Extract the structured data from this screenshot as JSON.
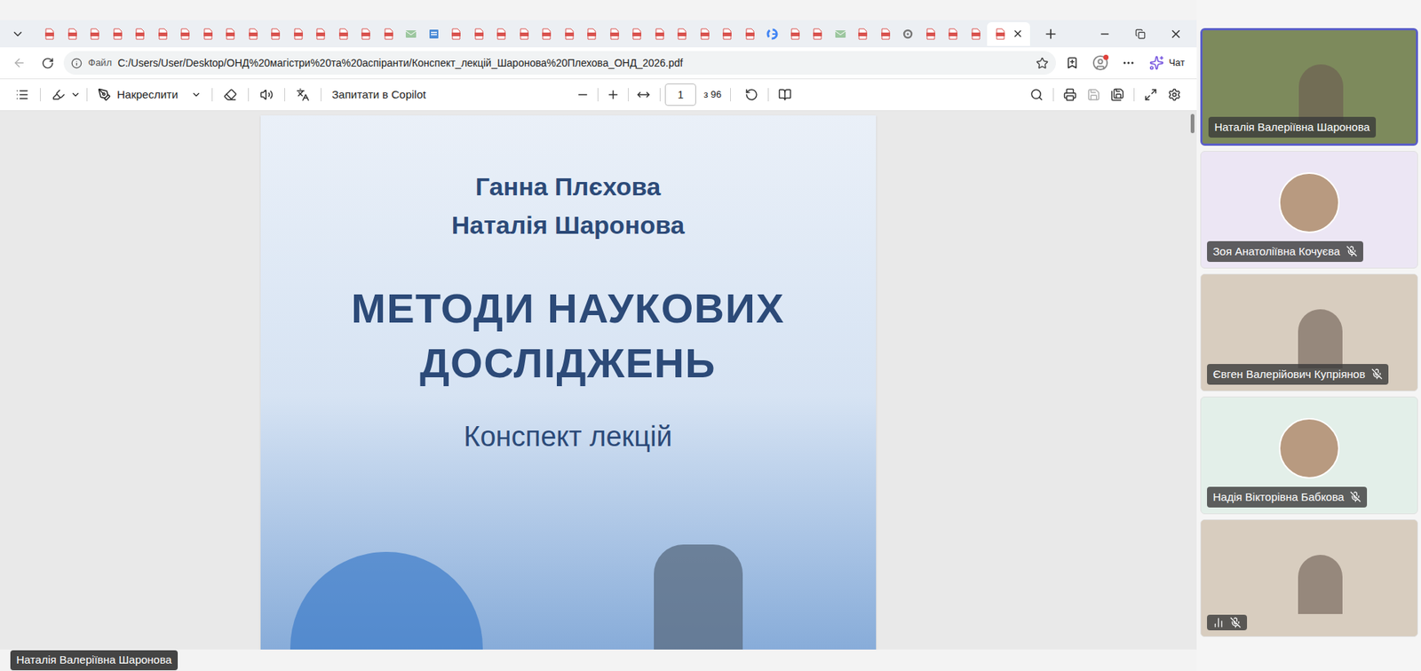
{
  "browser": {
    "tabs": [
      {
        "kind": "pdf",
        "selected": false
      },
      {
        "kind": "pdf",
        "selected": false
      },
      {
        "kind": "pdf",
        "selected": false
      },
      {
        "kind": "pdf",
        "selected": false
      },
      {
        "kind": "pdf",
        "selected": false
      },
      {
        "kind": "pdf",
        "selected": false
      },
      {
        "kind": "pdf",
        "selected": false
      },
      {
        "kind": "pdf",
        "selected": false
      },
      {
        "kind": "pdf",
        "selected": false
      },
      {
        "kind": "pdf",
        "selected": false
      },
      {
        "kind": "pdf",
        "selected": false
      },
      {
        "kind": "pdf",
        "selected": false
      },
      {
        "kind": "pdf",
        "selected": false
      },
      {
        "kind": "pdf",
        "selected": false
      },
      {
        "kind": "pdf",
        "selected": false
      },
      {
        "kind": "pdf",
        "selected": false
      },
      {
        "kind": "mail",
        "selected": false
      },
      {
        "kind": "docs",
        "selected": false
      },
      {
        "kind": "pdf",
        "selected": false
      },
      {
        "kind": "pdf",
        "selected": false
      },
      {
        "kind": "pdf",
        "selected": false
      },
      {
        "kind": "pdf",
        "selected": false
      },
      {
        "kind": "pdf",
        "selected": false
      },
      {
        "kind": "pdf",
        "selected": false
      },
      {
        "kind": "pdf",
        "selected": false
      },
      {
        "kind": "pdf",
        "selected": false
      },
      {
        "kind": "pdf",
        "selected": false
      },
      {
        "kind": "pdf",
        "selected": false
      },
      {
        "kind": "pdf",
        "selected": false
      },
      {
        "kind": "pdf",
        "selected": false
      },
      {
        "kind": "pdf",
        "selected": false
      },
      {
        "kind": "pdf",
        "selected": false
      },
      {
        "kind": "google",
        "selected": false
      },
      {
        "kind": "pdf",
        "selected": false
      },
      {
        "kind": "pdf",
        "selected": false
      },
      {
        "kind": "mail",
        "selected": false
      },
      {
        "kind": "pdf",
        "selected": false
      },
      {
        "kind": "pdf",
        "selected": false
      },
      {
        "kind": "tool",
        "selected": false
      },
      {
        "kind": "pdf",
        "selected": false
      },
      {
        "kind": "pdf",
        "selected": false
      },
      {
        "kind": "pdf",
        "selected": false
      },
      {
        "kind": "pdf",
        "selected": true
      }
    ],
    "address": {
      "scheme_label": "Файл",
      "url": "C:/Users/User/Desktop/ОНД%20магістри%20та%20аспіранти/Конспект_лекцій_Шаронова%20Плехова_ОНД_2026.pdf",
      "back_disabled": true
    },
    "chat_label": "Чат"
  },
  "pdf_toolbar": {
    "draw_label": "Накреслити",
    "copilot_label": "Запитати в Copilot",
    "page": "1",
    "page_total": "з 96",
    "save_disabled": true
  },
  "document": {
    "authors": [
      "Ганна Плєхова",
      "Наталія Шаронова"
    ],
    "title": [
      "МЕТОДИ НАУКОВИХ",
      "ДОСЛІДЖЕНЬ"
    ],
    "subtitle": "Конспект лекцій"
  },
  "presenter_label": "Наталія Валеріївна Шаронова",
  "participants": [
    {
      "name": "Наталія Валеріївна Шаронова",
      "kind": "video",
      "muted": false,
      "speaking": true,
      "signal": false,
      "color": "#7d8a5c"
    },
    {
      "name": "Зоя Анатоліївна Кочуєва",
      "kind": "avatar",
      "muted": true,
      "speaking": false,
      "signal": false,
      "color": "#ece6f4"
    },
    {
      "name": "Євген Валерійович Купріянов",
      "kind": "video",
      "muted": true,
      "speaking": false,
      "signal": false,
      "color": "#d8cdbf"
    },
    {
      "name": "Надія Вікторівна Бабкова",
      "kind": "avatar",
      "muted": true,
      "speaking": false,
      "signal": false,
      "color": "#e3efe9"
    },
    {
      "kind": "video",
      "muted": true,
      "speaking": false,
      "signal": true,
      "color": "#d8cdbf"
    }
  ]
}
